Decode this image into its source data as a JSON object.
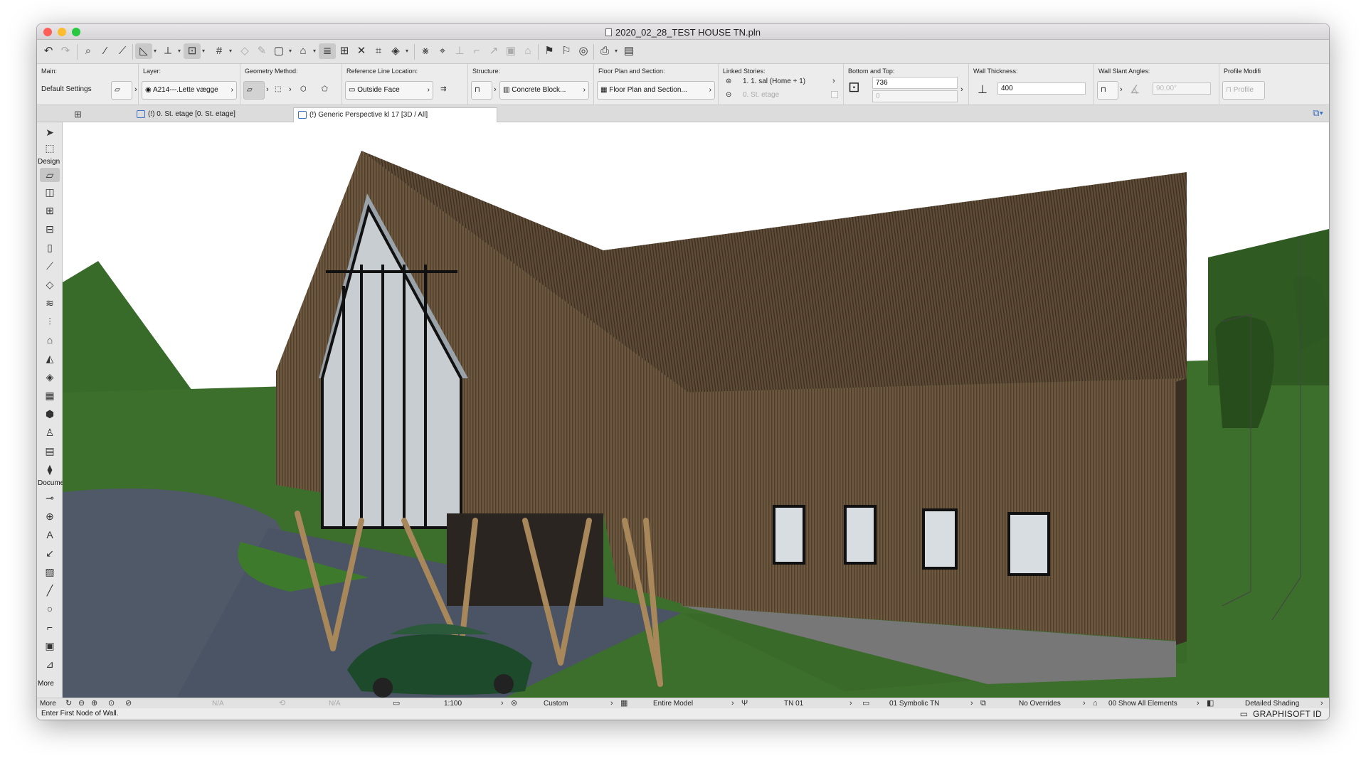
{
  "window": {
    "title": "2020_02_28_TEST HOUSE TN.pln"
  },
  "infobox": {
    "main": {
      "header": "Main:",
      "value": "Default Settings"
    },
    "layer": {
      "header": "Layer:",
      "value": "A214---.Lette vægge"
    },
    "geometry": {
      "header": "Geometry Method:"
    },
    "refline": {
      "header": "Reference Line Location:",
      "value": "Outside Face"
    },
    "structure": {
      "header": "Structure:",
      "value": "Concrete Block..."
    },
    "floorplan": {
      "header": "Floor Plan and Section:",
      "value": "Floor Plan and Section..."
    },
    "linked": {
      "header": "Linked Stories:",
      "top": "1. 1. sal (Home + 1)",
      "bottom": "0. St. etage"
    },
    "bottomtop": {
      "header": "Bottom and Top:",
      "height": "736",
      "offset": "0"
    },
    "thickness": {
      "header": "Wall Thickness:",
      "value": "400"
    },
    "slant": {
      "header": "Wall Slant Angles:",
      "value": "90,00°"
    },
    "profile": {
      "header": "Profile Modifi",
      "value": "Profile"
    }
  },
  "tabs": [
    {
      "label": "(!) 0. St. etage [0. St. etage]"
    },
    {
      "label": "(!) Generic Perspective kl 17 [3D / All]"
    }
  ],
  "toolbox": {
    "design_label": "Design",
    "document_label": "Docume",
    "more_label": "More"
  },
  "statusbar": {
    "na1": "N/A",
    "na2": "N/A",
    "scale": "1:100",
    "pen": "Custom",
    "model": "Entire Model",
    "combo": "TN 01",
    "display": "01 Symbolic TN",
    "overrides": "No Overrides",
    "renovation": "00 Show All Elements",
    "shading": "Detailed Shading"
  },
  "message": "Enter First Node of Wall.",
  "brand": "GRAPHISOFT ID",
  "colors": {
    "close": "#fe5f57",
    "minimize": "#febc2e",
    "zoom": "#28c840",
    "accent": "#3a6fc1"
  }
}
